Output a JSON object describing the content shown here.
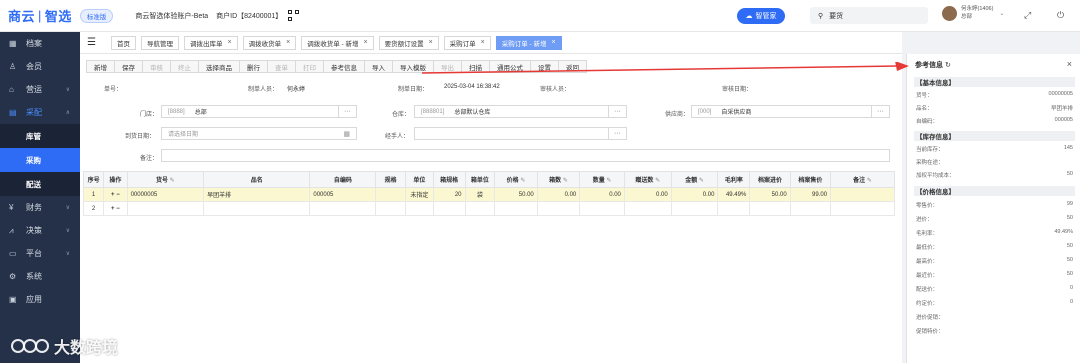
{
  "header": {
    "logo_left": "商云",
    "logo_right": "智选",
    "edition": "标准版",
    "shop_name": "商云智选体验账户-Beta",
    "account_id": "商户ID【82400001】",
    "smart_button": "智管家",
    "search_value": "要货",
    "user_name": "何永婷(1406)",
    "user_role": "总部",
    "icons": [
      "qr-code-icon",
      "cloud-icon",
      "search-icon",
      "fullscreen-icon",
      "power-icon"
    ]
  },
  "sidebar": {
    "items": [
      {
        "icon": "grid-icon",
        "label": "档案",
        "expandable": false
      },
      {
        "icon": "person-icon",
        "label": "会员",
        "expandable": false
      },
      {
        "icon": "shop-icon",
        "label": "营运",
        "expandable": true
      },
      {
        "icon": "cart-icon",
        "label": "采配",
        "expandable": true,
        "expanded": true
      },
      {
        "icon": "money-icon",
        "label": "财务",
        "expandable": true
      },
      {
        "icon": "chart-icon",
        "label": "决策",
        "expandable": true
      },
      {
        "icon": "monitor-icon",
        "label": "平台",
        "expandable": true
      },
      {
        "icon": "settings-icon",
        "label": "系统",
        "expandable": false
      },
      {
        "icon": "app-icon",
        "label": "应用",
        "expandable": false
      }
    ],
    "subitems": [
      {
        "label": "库管",
        "current": false
      },
      {
        "label": "采购",
        "current": true
      },
      {
        "label": "配送",
        "current": false
      }
    ]
  },
  "tabs": [
    {
      "label": "首页",
      "closable": false,
      "current": false
    },
    {
      "label": "导航管理",
      "closable": false,
      "current": false
    },
    {
      "label": "调拨出库单",
      "closable": true,
      "current": false
    },
    {
      "label": "调拨收货单",
      "closable": true,
      "current": false
    },
    {
      "label": "调拨收货单 - 新增",
      "closable": true,
      "current": false
    },
    {
      "label": "要货额订设置",
      "closable": true,
      "current": false
    },
    {
      "label": "采购订单",
      "closable": true,
      "current": false
    },
    {
      "label": "采购订单 - 新增",
      "closable": true,
      "current": true
    }
  ],
  "toolbar": [
    {
      "label": "新增",
      "enabled": true
    },
    {
      "label": "保存",
      "enabled": true
    },
    {
      "label": "审核",
      "enabled": false
    },
    {
      "label": "终止",
      "enabled": false
    },
    {
      "label": "选择商品",
      "enabled": true
    },
    {
      "label": "删行",
      "enabled": true
    },
    {
      "label": "查单",
      "enabled": false
    },
    {
      "label": "打印",
      "enabled": false
    },
    {
      "label": "参考信息",
      "enabled": true
    },
    {
      "label": "导入",
      "enabled": true
    },
    {
      "label": "导入模版",
      "enabled": true
    },
    {
      "label": "导出",
      "enabled": false
    },
    {
      "label": "扫描",
      "enabled": true
    },
    {
      "label": "通用公式",
      "enabled": true
    },
    {
      "label": "设置",
      "enabled": true
    },
    {
      "label": "返回",
      "enabled": true
    }
  ],
  "form": {
    "doc_no_label": "单号：",
    "creator_label": "制单人员：",
    "creator_value": "何永婷",
    "create_date_label": "制单日期：",
    "create_date_value": "2025-03-04 16:38:42",
    "reviewer_label": "审核人员：",
    "review_date_label": "审核日期：",
    "store_label": "门店：",
    "store_code": "[8888]",
    "store_name": "总部",
    "warehouse_label": "仓库：",
    "warehouse_code": "[888801]",
    "warehouse_name": "总部默认仓库",
    "supplier_label": "供应商：",
    "supplier_code": "[000]",
    "supplier_name": "自采供应商",
    "arrival_label": "到货日期：",
    "arrival_placeholder": "请选择日期",
    "handler_label": "经手人：",
    "remark_label": "备注：",
    "more_symbol": "···"
  },
  "table": {
    "columns": [
      "序号",
      "操作",
      "货号",
      "品名",
      "自编码",
      "规格",
      "单位",
      "箱规格",
      "箱单位",
      "价格",
      "箱数",
      "数量",
      "赠送数",
      "金额",
      "毛利率",
      "档案进价",
      "档案售价",
      "备注"
    ],
    "editable_mark": "✎",
    "rows": [
      {
        "seq": "1",
        "ops": "+ −",
        "sku": "00000005",
        "name": "早团羊排",
        "code": "000005",
        "spec": "",
        "unit": "未指定",
        "box_spec": "20",
        "box_unit": "袋",
        "price": "50.00",
        "boxes": "0.00",
        "qty": "0.00",
        "gift": "0.00",
        "amount": "0.00",
        "margin": "49.49%",
        "cost": "50.00",
        "sale": "99.00",
        "remark": ""
      },
      {
        "seq": "2",
        "ops": "+ −",
        "sku": "",
        "name": "",
        "code": "",
        "spec": "",
        "unit": "",
        "box_spec": "",
        "box_unit": "",
        "price": "",
        "boxes": "",
        "qty": "",
        "gift": "",
        "amount": "",
        "margin": "",
        "cost": "",
        "sale": "",
        "remark": ""
      }
    ]
  },
  "ref_panel": {
    "title": "参考信息",
    "close": "×",
    "sections": [
      {
        "title": "【基本信息】",
        "rows": [
          {
            "label": "货号：",
            "value": "00000005"
          },
          {
            "label": "品名：",
            "value": "早团羊排"
          },
          {
            "label": "自编码：",
            "value": "000005"
          }
        ]
      },
      {
        "title": "【库存信息】",
        "rows": [
          {
            "label": "当前库存：",
            "value": "145"
          },
          {
            "label": "采购在途：",
            "value": ""
          },
          {
            "label": "加权平均成本：",
            "value": "50"
          }
        ]
      },
      {
        "title": "【价格信息】",
        "rows": [
          {
            "label": "零售价：",
            "value": "99"
          },
          {
            "label": "进价：",
            "value": "50"
          },
          {
            "label": "毛利率：",
            "value": "49.49%"
          },
          {
            "label": "最低价：",
            "value": "50"
          },
          {
            "label": "最高价：",
            "value": "50"
          },
          {
            "label": "最近价：",
            "value": "50"
          },
          {
            "label": "配送价：",
            "value": "0"
          },
          {
            "label": "约定价：",
            "value": "0"
          },
          {
            "label": "进价促销：",
            "value": ""
          },
          {
            "label": "促销特价：",
            "value": ""
          }
        ]
      }
    ]
  },
  "watermark": "大数跨境",
  "colors": {
    "accent": "#2f6cf6",
    "sidebar": "#243148",
    "active_tab": "#6f9cf4",
    "row_highlight": "#fbf7d0",
    "annotation_arrow": "#e53935"
  }
}
